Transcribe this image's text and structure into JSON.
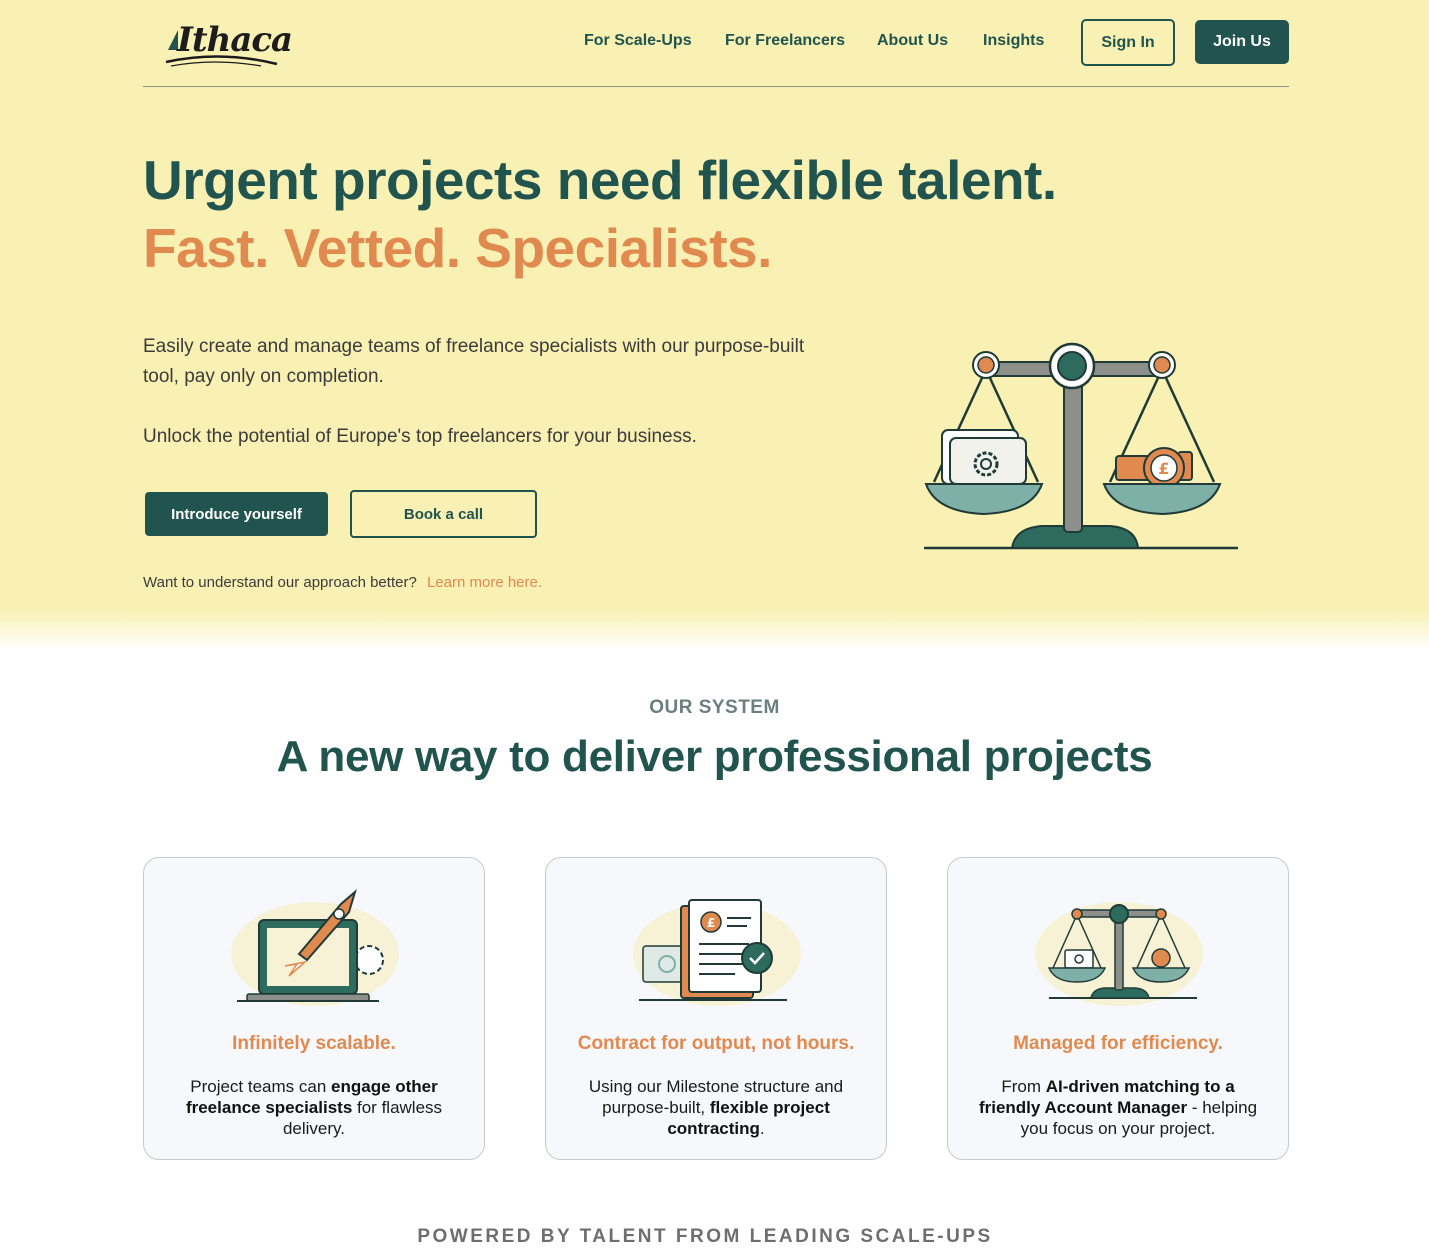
{
  "brand": {
    "logo_text": "Ithaca"
  },
  "nav": {
    "links": [
      "For Scale-Ups",
      "For Freelancers",
      "About Us",
      "Insights"
    ],
    "sign_in": "Sign In",
    "join_us": "Join Us"
  },
  "hero": {
    "headline": "Urgent projects need flexible talent.",
    "subheadline": "Fast. Vetted. Specialists.",
    "paragraph1": "Easily create and manage teams of freelance specialists with our purpose-built tool, pay only on completion.",
    "paragraph2": "Unlock the potential of Europe's top freelancers for your business.",
    "cta_primary": "Introduce yourself",
    "cta_secondary": "Book a call",
    "learn_prompt": "Want to understand our approach better?",
    "learn_link": "Learn more here."
  },
  "system": {
    "kicker": "OUR SYSTEM",
    "title": "A new way to deliver professional projects",
    "cards": [
      {
        "icon": "rocket-laptop-icon",
        "title": "Infinitely scalable.",
        "body_parts": [
          "Project teams can ",
          "engage other freelance specialists",
          " for flawless delivery."
        ]
      },
      {
        "icon": "contract-document-icon",
        "title": "Contract for output, not hours.",
        "body_parts": [
          "Using our Milestone structure and purpose-built, ",
          "flexible project contracting",
          "."
        ]
      },
      {
        "icon": "balance-scale-icon",
        "title": "Managed for efficiency.",
        "body_parts": [
          "From ",
          "AI-driven matching to a friendly Account Manager",
          " - helping you focus on your project."
        ]
      }
    ]
  },
  "powered": {
    "text": "POWERED BY TALENT FROM LEADING SCALE-UPS"
  },
  "colors": {
    "brand_green": "#21544f",
    "accent_orange": "#e08a50",
    "hero_bg": "#f8f1b3",
    "teal_light": "#7fb0a8"
  }
}
